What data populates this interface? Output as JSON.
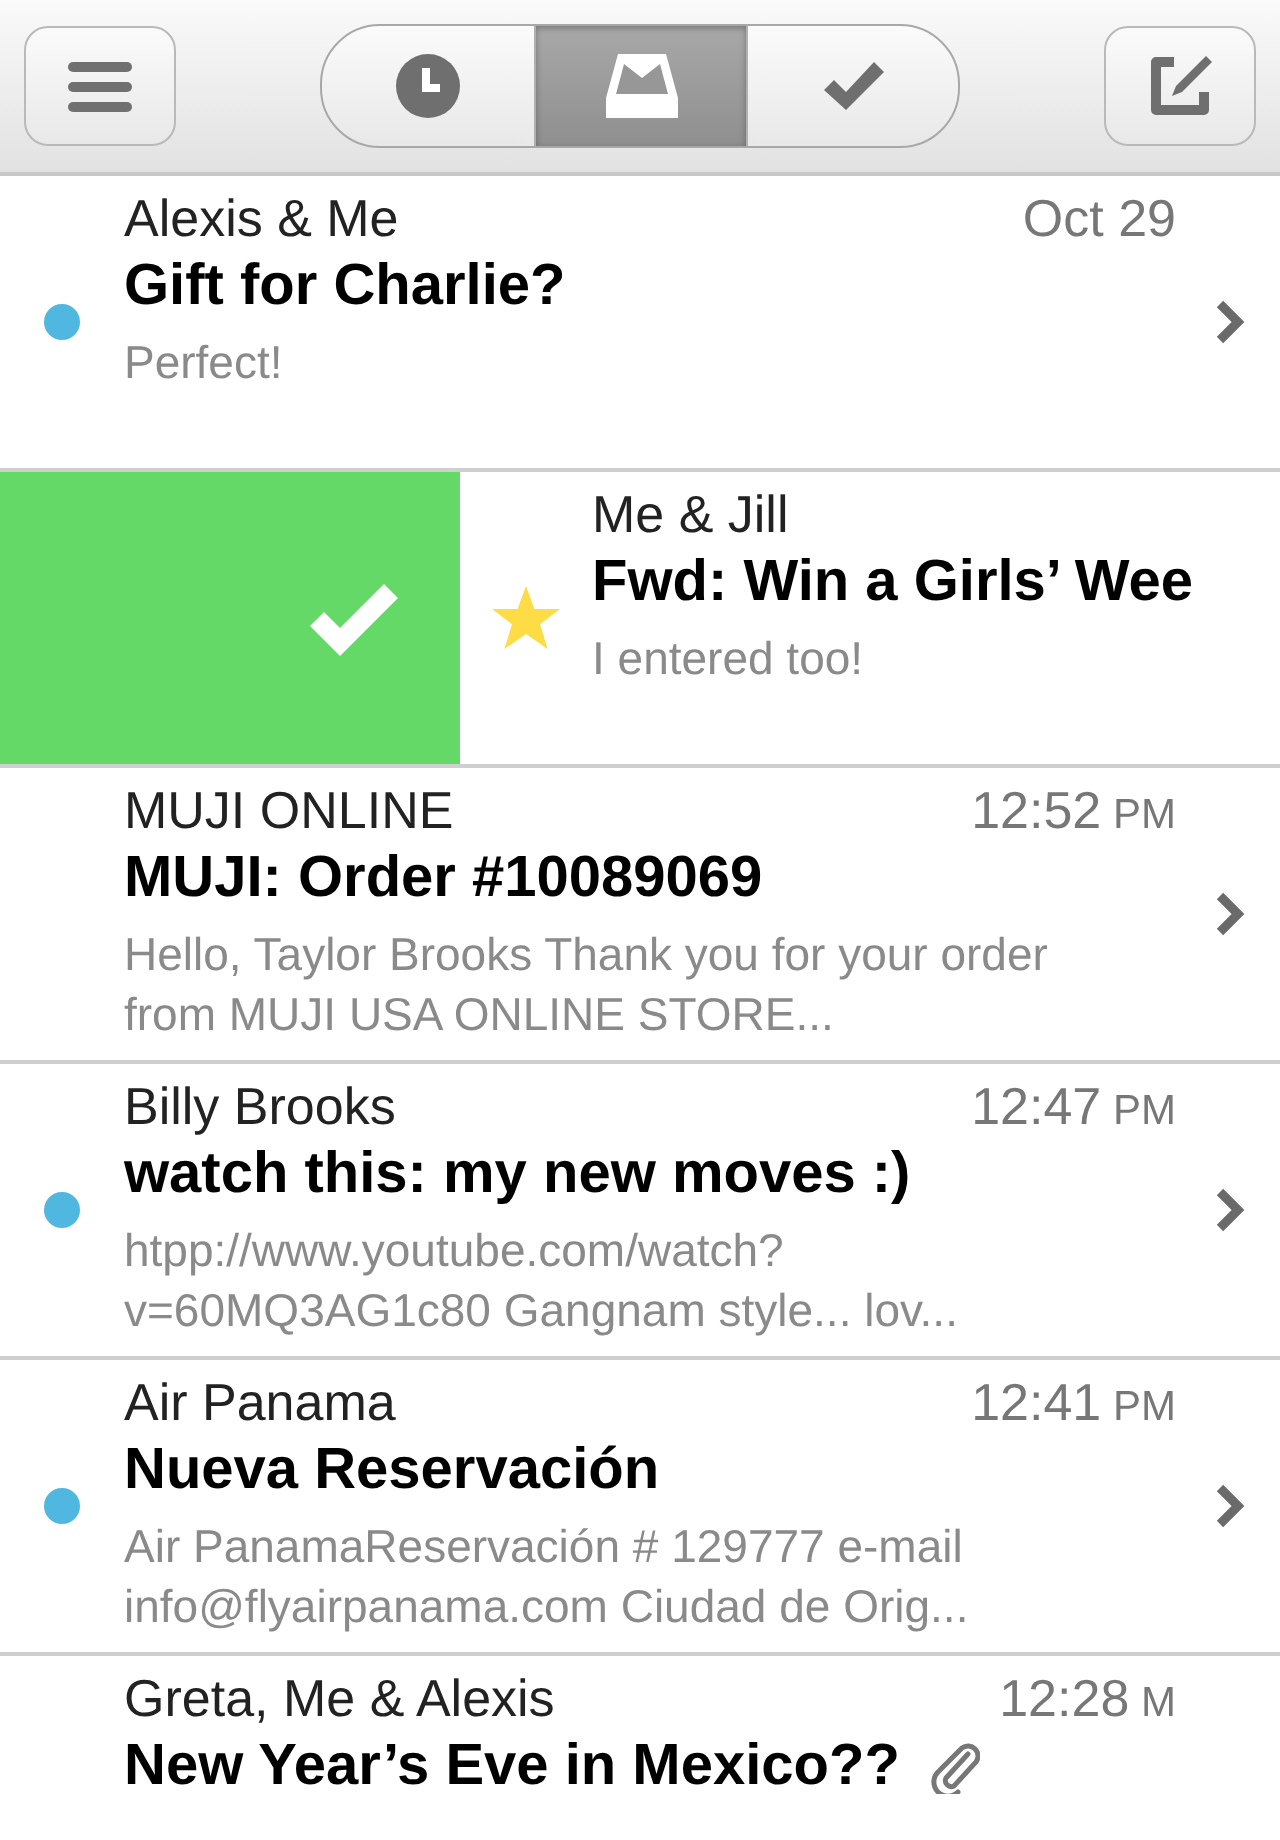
{
  "toolbar": {
    "tabs": [
      {
        "kind": "later",
        "selected": false
      },
      {
        "kind": "inbox",
        "selected": true
      },
      {
        "kind": "done",
        "selected": false
      }
    ]
  },
  "messages": [
    {
      "kind": "message",
      "sender": "Alexis & Me",
      "time": "Oct 29",
      "subject": "Gift for Charlie?",
      "preview": "Perfect!",
      "unread": true,
      "starred": false,
      "attachment": false,
      "chevron": true
    },
    {
      "kind": "swiped",
      "sender": "Me & Jill",
      "subject": "Fwd: Win a Girls’ Wee",
      "preview": "I entered too!",
      "unread": false,
      "starred": true,
      "attachment": false,
      "chevron": false
    },
    {
      "kind": "message",
      "sender": "MUJI ONLINE",
      "time": "12:52",
      "meridiem": "PM",
      "subject": "MUJI: Order #10089069",
      "preview": "Hello, Taylor Brooks Thank you for your order from MUJI USA ONLINE STORE...",
      "unread": false,
      "starred": false,
      "attachment": false,
      "chevron": true
    },
    {
      "kind": "message",
      "sender": "Billy Brooks",
      "time": "12:47",
      "meridiem": "PM",
      "subject": "watch this: my new moves :)",
      "preview": "htpp://www.youtube.com/watch?v=60MQ3AG1c80 Gangnam style... lov...",
      "unread": true,
      "starred": false,
      "attachment": false,
      "chevron": true
    },
    {
      "kind": "message",
      "sender": "Air Panama",
      "time": "12:41",
      "meridiem": "PM",
      "subject": "Nueva Reservación",
      "preview": "Air PanamaReservación # 129777 e-mail info@flyairpanama.com Ciudad de Orig...",
      "unread": true,
      "starred": false,
      "attachment": false,
      "chevron": true
    },
    {
      "kind": "message",
      "sender": "Greta, Me & Alexis",
      "time": "12:28",
      "meridiem": "M",
      "subject": "New Year’s Eve in Mexico??",
      "unread": false,
      "starred": false,
      "attachment": true,
      "chevron": false
    }
  ]
}
